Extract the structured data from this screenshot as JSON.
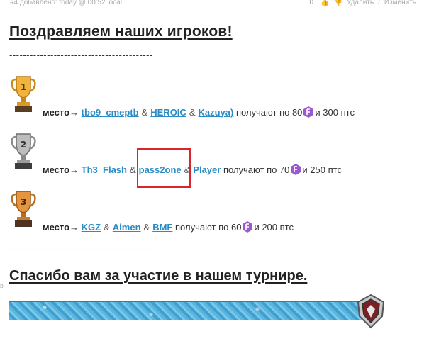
{
  "meta": {
    "post_info": "#4 добавлено: today @ 00:52 local",
    "vote_count": "0",
    "delete_label": "Удалить",
    "edit_label": "Изменить",
    "separator": "/"
  },
  "title": "Поздравляем наших игроков!",
  "divider": "------------------------------------------",
  "places": [
    {
      "rank": "1",
      "label": "место",
      "arrow": "→",
      "players": [
        "tbo9_cmeptb",
        "HEROIC",
        "Kazuya)"
      ],
      "reward_prefix": "получают по 80",
      "reward_suffix": "и 300 птс",
      "trophy_color": "#e3a43a"
    },
    {
      "rank": "2",
      "label": "место",
      "arrow": "→",
      "players": [
        "Th3_Flash",
        "pass2one",
        "Player"
      ],
      "reward_prefix": "получают по 70",
      "reward_suffix": "и 250 птс",
      "trophy_color": "#9c9c9c"
    },
    {
      "rank": "3",
      "label": "место",
      "arrow": "→",
      "players": [
        "KGZ",
        "Aimen",
        "BMF"
      ],
      "reward_prefix": "получают по 60",
      "reward_suffix": "и 200 птс",
      "trophy_color": "#d98a3a"
    }
  ],
  "amp": "&",
  "thanks": "Спасибо вам за участие в нашем турнире.",
  "left_mark": "в",
  "colors": {
    "link": "#2a8bc5",
    "highlight": "#d9262e",
    "gem": "#9b59d0"
  }
}
